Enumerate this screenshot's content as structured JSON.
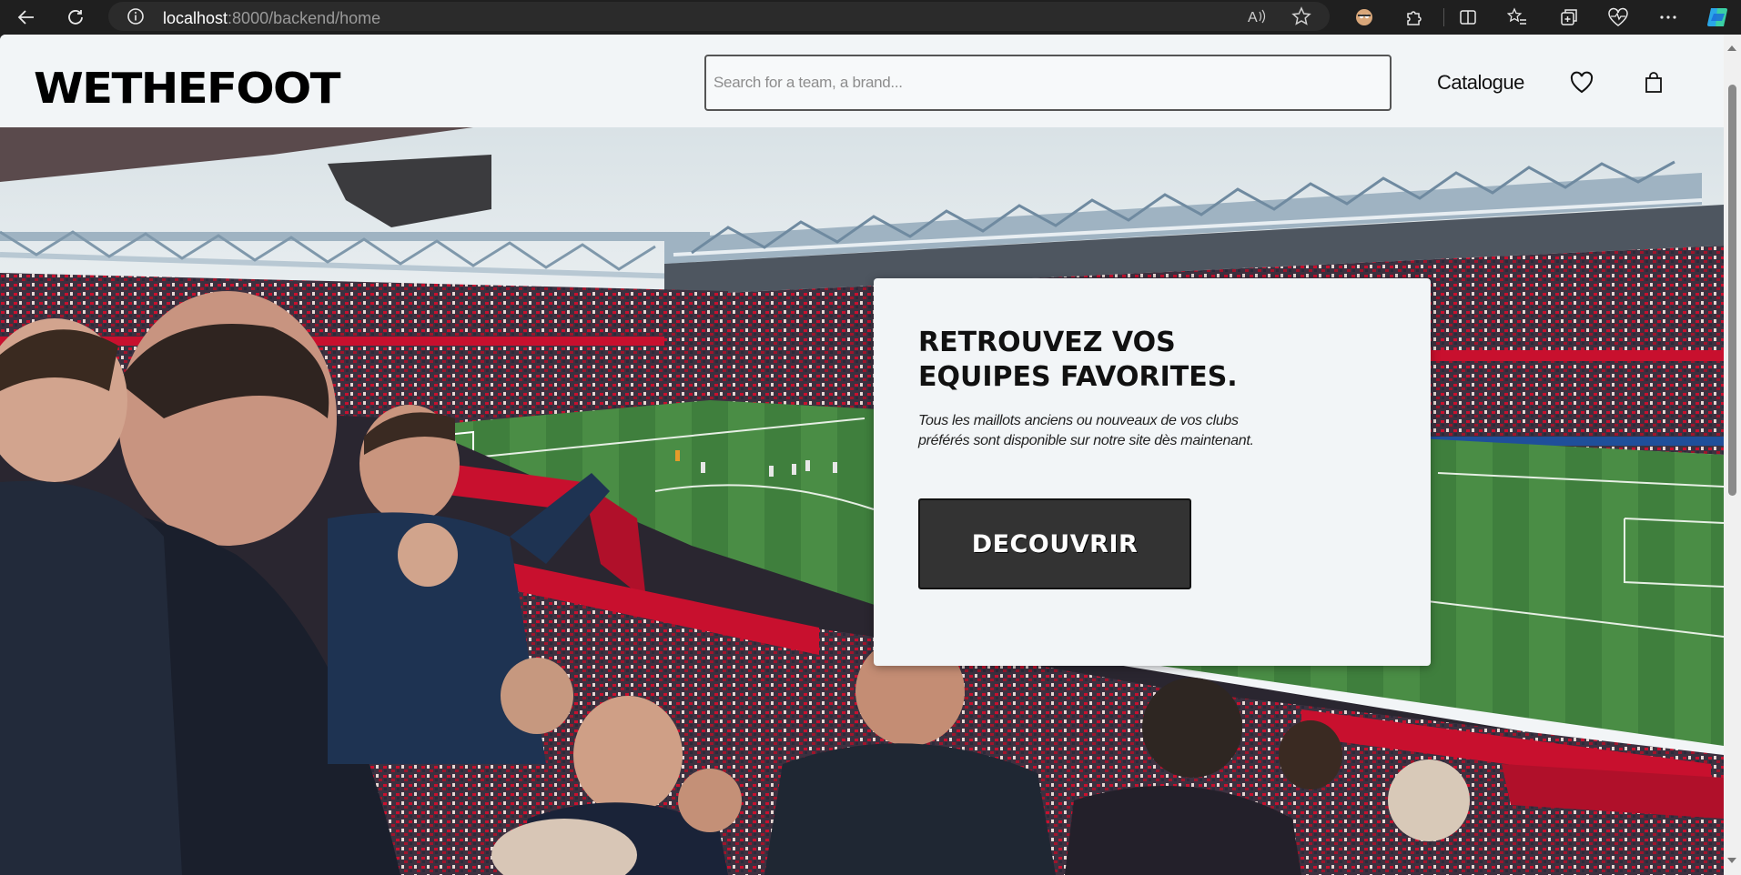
{
  "browser": {
    "url_host": "localhost",
    "url_path": ":8000/backend/home"
  },
  "header": {
    "logo": "WETHEFOOT",
    "search_placeholder": "Search for a team, a brand...",
    "catalogue_label": "Catalogue"
  },
  "hero": {
    "title_line1": "RETROUVEZ VOS",
    "title_line2": "EQUIPES FAVORITES.",
    "text_line1": "Tous les maillots anciens ou nouveaux de vos clubs",
    "text_line2": "préférés sont disponible sur notre site dès maintenant.",
    "button_label": "DECOUVRIR"
  },
  "colors": {
    "page_bg": "#f2f5f7",
    "button_bg": "#333333",
    "pitch": "#3c7a3c",
    "scarf_red": "#c8102e"
  }
}
